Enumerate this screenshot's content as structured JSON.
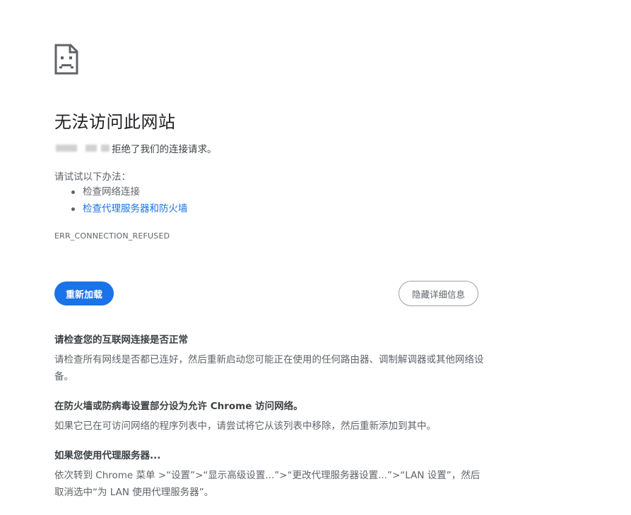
{
  "error_icon": "sad-page-icon",
  "title": "无法访问此网站",
  "host_redacted": true,
  "refused_suffix": "拒绝了我们的连接请求。",
  "suggestions": {
    "intro": "请试试以下办法：",
    "items": [
      {
        "label": "检查网络连接",
        "is_link": false
      },
      {
        "label": "检查代理服务器和防火墙",
        "is_link": true
      }
    ]
  },
  "error_code": "ERR_CONNECTION_REFUSED",
  "buttons": {
    "reload": "重新加载",
    "details": "隐藏详细信息"
  },
  "details": [
    {
      "heading": "请检查您的互联网连接是否正常",
      "body": "请检查所有网线是否都已连好，然后重新启动您可能正在使用的任何路由器、调制解调器或其他网络设备。"
    },
    {
      "heading": "在防火墙或防病毒设置部分设为允许 Chrome 访问网络。",
      "body": "如果它已在可访问网络的程序列表中，请尝试将它从该列表中移除，然后重新添加到其中。"
    },
    {
      "heading": "如果您使用代理服务器...",
      "body": "依次转到 Chrome 菜单 >“设置”>“显示高级设置...”>“更改代理服务器设置...”>“LAN 设置”，然后取消选中“为 LAN 使用代理服务器”。"
    }
  ],
  "colors": {
    "accent": "#1a73e8",
    "text_primary": "#202124",
    "text_secondary": "#5f6368"
  }
}
